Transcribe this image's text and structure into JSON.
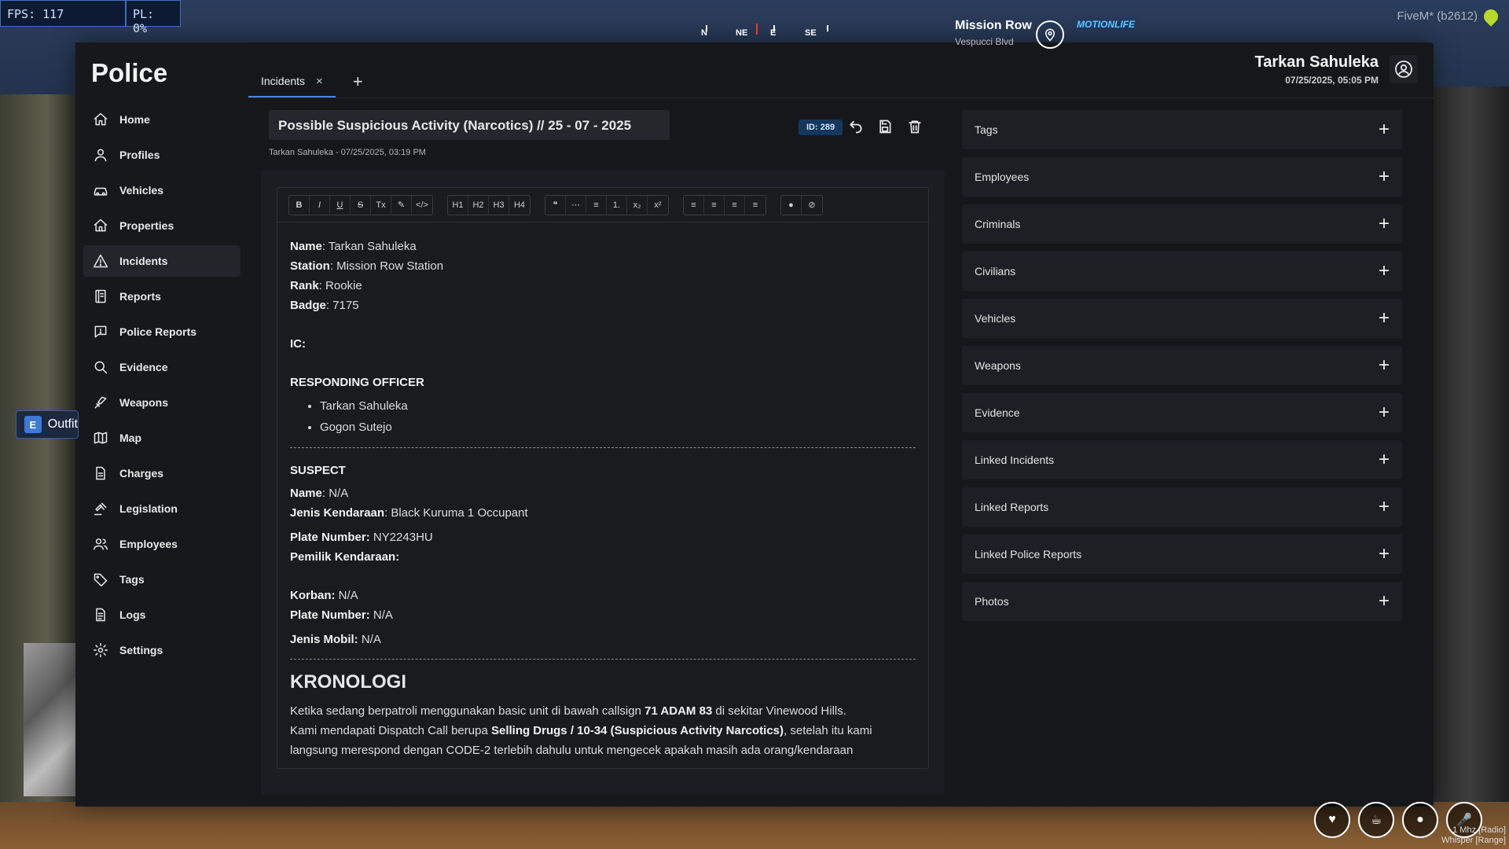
{
  "hud": {
    "fps": "FPS: 117",
    "pl": "PL: 0%",
    "compass": [
      "N",
      "NE",
      "E",
      "SE"
    ],
    "street": "Mission Row",
    "street_sub": "Vespucci Blvd",
    "logo": "MOTIONLIFE",
    "client": "FiveM* (b2612)",
    "prompt_key": "E",
    "prompt_text": "Outfit",
    "radio_line1": "1 Mhz [Radio]",
    "radio_line2": "Whisper [Range]"
  },
  "app": {
    "brand": "Police",
    "nav": [
      {
        "label": "Home",
        "icon": "home-icon"
      },
      {
        "label": "Profiles",
        "icon": "user-icon"
      },
      {
        "label": "Vehicles",
        "icon": "car-icon"
      },
      {
        "label": "Properties",
        "icon": "house-icon"
      },
      {
        "label": "Incidents",
        "icon": "warning-icon"
      },
      {
        "label": "Reports",
        "icon": "report-icon"
      },
      {
        "label": "Police Reports",
        "icon": "message-icon"
      },
      {
        "label": "Evidence",
        "icon": "search-icon"
      },
      {
        "label": "Weapons",
        "icon": "weapon-icon"
      },
      {
        "label": "Map",
        "icon": "map-icon"
      },
      {
        "label": "Charges",
        "icon": "file-icon"
      },
      {
        "label": "Legislation",
        "icon": "gavel-icon"
      },
      {
        "label": "Employees",
        "icon": "users-icon"
      },
      {
        "label": "Tags",
        "icon": "tag-icon"
      },
      {
        "label": "Logs",
        "icon": "log-icon"
      },
      {
        "label": "Settings",
        "icon": "gear-icon"
      }
    ],
    "active_nav": "Incidents",
    "tabs": [
      {
        "label": "Incidents",
        "close": "×"
      }
    ],
    "tab_add": "+",
    "user": {
      "name": "Tarkan Sahuleka",
      "datetime": "07/25/2025, 05:05 PM"
    }
  },
  "incident": {
    "title": "Possible Suspicious Activity (Narcotics) // 25 - 07 - 2025",
    "meta": "Tarkan Sahuleka - 07/25/2025, 03:19 PM",
    "id_badge": "ID: 289"
  },
  "toolbar": {
    "group1": [
      "B",
      "I",
      "U",
      "S",
      "Tx",
      "✎",
      "</>"
    ],
    "group2": [
      "H1",
      "H2",
      "H3",
      "H4"
    ],
    "group3": [
      "❝",
      "⋯",
      "≡",
      "1.",
      "x₂",
      "x²"
    ],
    "group4": [
      "≡",
      "≡",
      "≡",
      "≡"
    ],
    "group5": [
      "●",
      "⊘"
    ]
  },
  "content": {
    "name_label": "Name",
    "name_value": ": Tarkan Sahuleka",
    "station_label": "Station",
    "station_value": ": Mission Row Station",
    "rank_label": "Rank",
    "rank_value": ": Rookie",
    "badge_label": "Badge",
    "badge_value": ": 7175",
    "ic_label": "IC:",
    "responding_heading": "RESPONDING OFFICER",
    "officers": [
      "Tarkan Sahuleka",
      "Gogon Sutejo"
    ],
    "suspect_heading": "SUSPECT",
    "s_name_label": "Name",
    "s_name_value": ": N/A",
    "s_vehicle_label": "Jenis Kendaraan",
    "s_vehicle_value": ": Black Kuruma 1 Occupant",
    "s_plate_label": "Plate Number:",
    "s_plate_value": " NY2243HU",
    "s_owner_label": "Pemilik Kendaraan:",
    "v_label": "Korban:",
    "v_value": " N/A",
    "v_plate_label": "Plate Number:",
    "v_plate_value": " N/A",
    "v_car_label": "Jenis Mobil:",
    "v_car_value": " N/A",
    "kronologi_heading": "KRONOLOGI",
    "p1_a": "Ketika sedang berpatroli menggunakan basic unit di bawah callsign ",
    "p1_b": "71 ADAM 83",
    "p1_c": " di sekitar Vinewood Hills.",
    "p2_a": "Kami mendapati Dispatch Call berupa ",
    "p2_b": "Selling Drugs / 10-34 (Suspicious Activity Narcotics)",
    "p2_c": ", setelah itu kami",
    "p3": "langsung merespond dengan CODE-2 terlebih dahulu untuk mengecek apakah masih ada orang/kendaraan"
  },
  "sections": [
    "Tags",
    "Employees",
    "Criminals",
    "Civilians",
    "Vehicles",
    "Weapons",
    "Evidence",
    "Linked Incidents",
    "Linked Reports",
    "Linked Police Reports",
    "Photos"
  ],
  "section_add": "+"
}
